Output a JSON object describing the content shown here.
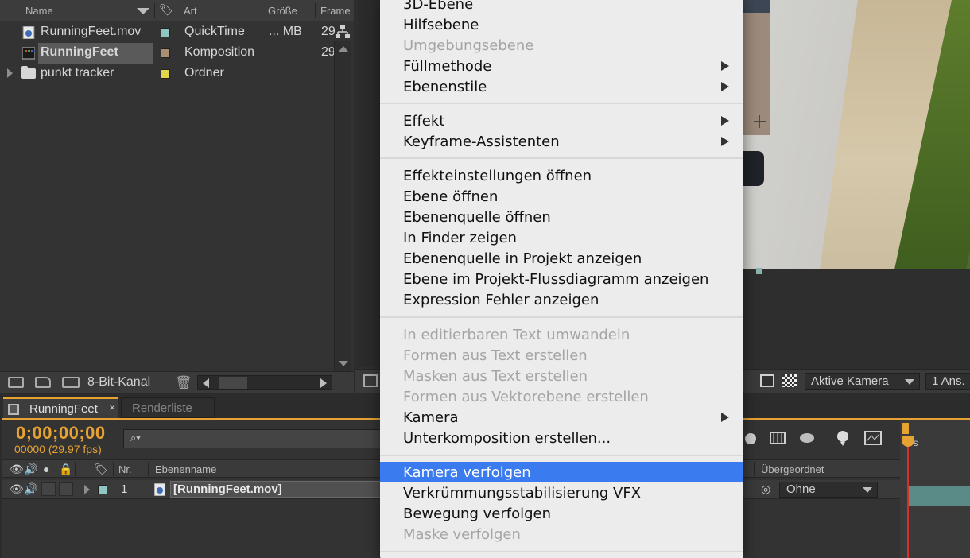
{
  "project": {
    "columns": {
      "name": "Name",
      "type": "Art",
      "size": "Größe",
      "frame": "Frame"
    },
    "items": [
      {
        "name": "RunningFeet.mov",
        "type": "QuickTime",
        "size": "... MB",
        "frame": "29",
        "swatch": "#8fc6c2"
      },
      {
        "name": "RunningFeet",
        "type": "Komposition",
        "size": "",
        "frame": "29",
        "swatch": "#a88f72"
      },
      {
        "name": "punkt tracker",
        "type": "Ordner",
        "size": "",
        "frame": "",
        "swatch": "#e2d64d"
      }
    ],
    "footer": {
      "bit_depth": "8-Bit-Kanal"
    }
  },
  "viewer": {
    "toolbar": {
      "camera": "Aktive Kamera",
      "views": "1 Ans."
    }
  },
  "timeline": {
    "tabs": {
      "active": "RunningFeet",
      "inactive": "Renderliste",
      "close": "×"
    },
    "timecode": "0;00;00;00",
    "fps": "00000 (29.97 fps)",
    "search_placeholder": "",
    "search_icon": "⌕▾",
    "columns": {
      "nr": "Nr.",
      "layer_name": "Ebenenname",
      "parent": "Übergeordnet"
    },
    "layer": {
      "number": "1",
      "name": "[RunningFeet.mov]",
      "parent": "Ohne"
    },
    "ruler_label": "0s"
  },
  "menu": {
    "items": [
      {
        "label": "3D-Ebene",
        "disabled": false,
        "submenu": false
      },
      {
        "label": "Hilfsebene",
        "disabled": false,
        "submenu": false
      },
      {
        "label": "Umgebungsebene",
        "disabled": true,
        "submenu": false
      },
      {
        "label": "Füllmethode",
        "disabled": false,
        "submenu": true
      },
      {
        "label": "Ebenenstile",
        "disabled": false,
        "submenu": true
      },
      {
        "label": "Effekt",
        "disabled": false,
        "submenu": true
      },
      {
        "label": "Keyframe-Assistenten",
        "disabled": false,
        "submenu": true
      },
      {
        "label": "Effekteinstellungen öffnen",
        "disabled": false,
        "submenu": false
      },
      {
        "label": "Ebene öffnen",
        "disabled": false,
        "submenu": false
      },
      {
        "label": "Ebenenquelle öffnen",
        "disabled": false,
        "submenu": false
      },
      {
        "label": "In Finder zeigen",
        "disabled": false,
        "submenu": false
      },
      {
        "label": "Ebenenquelle in Projekt anzeigen",
        "disabled": false,
        "submenu": false
      },
      {
        "label": "Ebene im Projekt-Flussdiagramm anzeigen",
        "disabled": false,
        "submenu": false
      },
      {
        "label": "Expression Fehler anzeigen",
        "disabled": false,
        "submenu": false
      },
      {
        "label": "In editierbaren Text umwandeln",
        "disabled": true,
        "submenu": false
      },
      {
        "label": "Formen aus Text erstellen",
        "disabled": true,
        "submenu": false
      },
      {
        "label": "Masken aus Text erstellen",
        "disabled": true,
        "submenu": false
      },
      {
        "label": "Formen aus Vektorebene erstellen",
        "disabled": true,
        "submenu": false
      },
      {
        "label": "Kamera",
        "disabled": false,
        "submenu": true
      },
      {
        "label": "Unterkomposition erstellen...",
        "disabled": false,
        "submenu": false
      },
      {
        "label": "Kamera verfolgen",
        "disabled": false,
        "submenu": false,
        "highlighted": true
      },
      {
        "label": "Verkrümmungsstabilisierung VFX",
        "disabled": false,
        "submenu": false
      },
      {
        "label": "Bewegung verfolgen",
        "disabled": false,
        "submenu": false
      },
      {
        "label": "Maske verfolgen",
        "disabled": true,
        "submenu": false
      }
    ]
  },
  "colors": {
    "accent": "#e7a332",
    "highlight": "#3b7bf0",
    "cti": "#d6302c"
  }
}
